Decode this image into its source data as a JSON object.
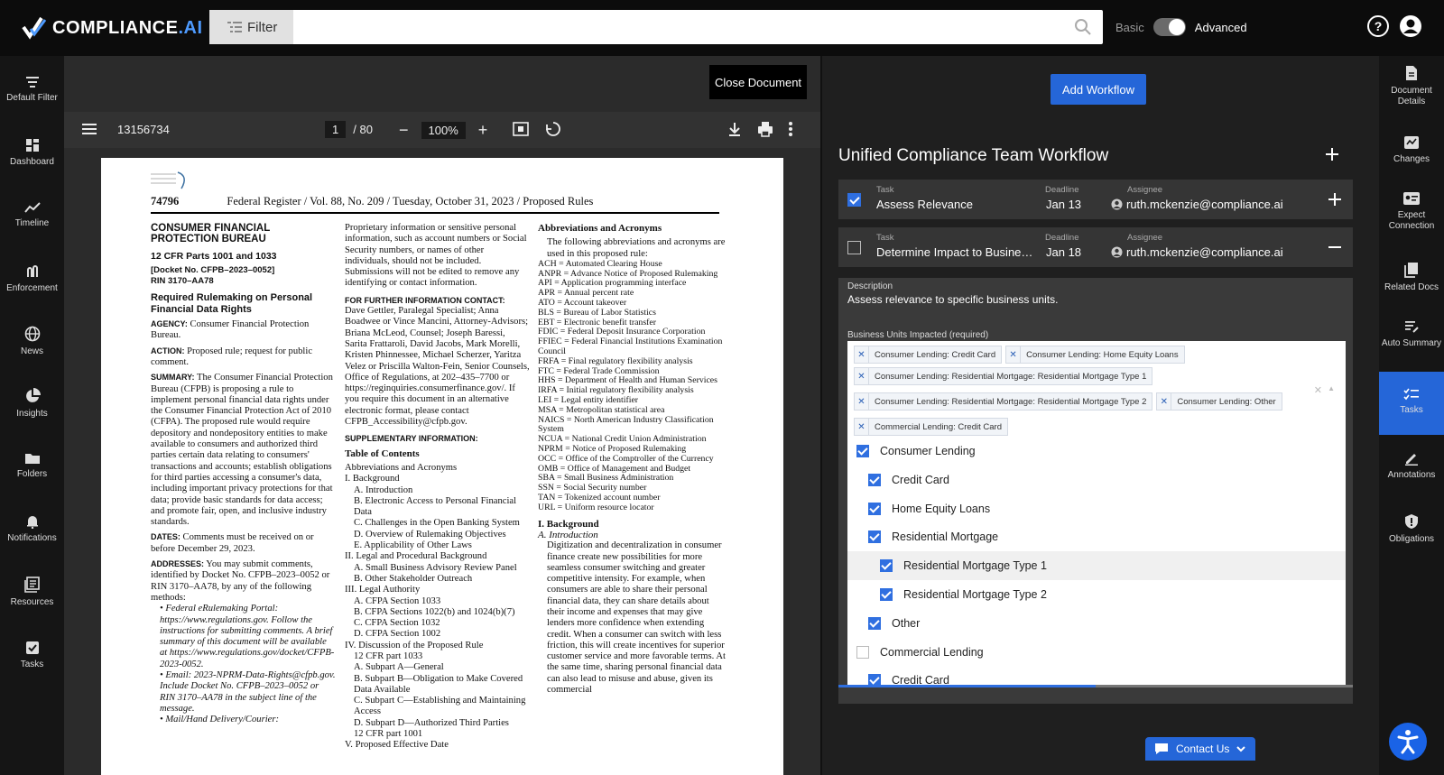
{
  "app": {
    "logo_main": "COMPLIANCE",
    "logo_suffix": ".AI"
  },
  "search": {
    "filter_label": "Filter",
    "placeholder": ""
  },
  "mode_toggle": {
    "left": "Basic",
    "right": "Advanced",
    "selected": "Advanced"
  },
  "left_nav": [
    {
      "label": "Default Filter",
      "icon": "filter-lines-icon"
    },
    {
      "label": "Dashboard",
      "icon": "dashboard-icon"
    },
    {
      "label": "Timeline",
      "icon": "timeline-icon"
    },
    {
      "label": "Enforcement",
      "icon": "enforcement-icon"
    },
    {
      "label": "News",
      "icon": "globe-icon"
    },
    {
      "label": "Insights",
      "icon": "pie-chart-icon"
    },
    {
      "label": "Folders",
      "icon": "folder-icon"
    },
    {
      "label": "Notifications",
      "icon": "bell-icon"
    },
    {
      "label": "Resources",
      "icon": "resources-icon"
    },
    {
      "label": "Tasks",
      "icon": "checkbox-icon"
    }
  ],
  "right_nav": [
    {
      "label": "Document Details",
      "icon": "document-icon"
    },
    {
      "label": "Changes",
      "icon": "changes-icon"
    },
    {
      "label": "Expect Connection",
      "icon": "connection-icon"
    },
    {
      "label": "Related Docs",
      "icon": "related-docs-icon"
    },
    {
      "label": "Auto Summary",
      "icon": "summary-icon"
    },
    {
      "label": "Tasks",
      "icon": "tasks-icon",
      "active": true
    },
    {
      "label": "Annotations",
      "icon": "pen-icon"
    },
    {
      "label": "Obligations",
      "icon": "shield-icon"
    }
  ],
  "document": {
    "close_label": "Close Document",
    "doc_id": "13156734",
    "page_current": "1",
    "page_total": "/ 80",
    "zoom": "100%",
    "header": {
      "page_number": "74796",
      "publication": "Federal Register / Vol. 88, No. 209 / Tuesday, October 31, 2023 / Proposed Rules"
    },
    "col1": {
      "agency": "CONSUMER FINANCIAL PROTECTION BUREAU",
      "cfr": "12 CFR Parts 1001 and 1033",
      "docket": "[Docket No. CFPB–2023–0052]",
      "rin": "RIN 3170–AA78",
      "rule_title": "Required Rulemaking on Personal Financial Data Rights",
      "agency_label": "AGENCY:",
      "agency_text": "Consumer Financial Protection Bureau.",
      "action_label": "ACTION:",
      "action_text": "Proposed rule; request for public comment.",
      "summary_label": "SUMMARY:",
      "summary_text": "The Consumer Financial Protection Bureau (CFPB) is proposing a rule to implement personal financial data rights under the Consumer Financial Protection Act of 2010 (CFPA). The proposed rule would require depository and nondepository entities to make available to consumers and authorized third parties certain data relating to consumers' transactions and accounts; establish obligations for third parties accessing a consumer's data, including important privacy protections for that data; provide basic standards for data access; and promote fair, open, and inclusive industry standards.",
      "dates_label": "DATES:",
      "dates_text": "Comments must be received on or before December 29, 2023.",
      "addresses_label": "ADDRESSES:",
      "addresses_text": "You may submit comments, identified by Docket No. CFPB–2023–0052 or RIN 3170–AA78, by any of the following methods:",
      "bullet1": "• Federal eRulemaking Portal: https://www.regulations.gov. Follow the instructions for submitting comments. A brief summary of this document will be available at https://www.regulations.gov/docket/CFPB-2023-0052.",
      "bullet2": "• Email: 2023-NPRM-Data-Rights@cfpb.gov. Include Docket No. CFPB–2023–0052 or RIN 3170–AA78 in the subject line of the message.",
      "bullet3": "• Mail/Hand Delivery/Courier:"
    },
    "col2": {
      "intro": "Proprietary information or sensitive personal information, such as account numbers or Social Security numbers, or names of other individuals, should not be included. Submissions will not be edited to remove any identifying or contact information.",
      "contact_label": "FOR FURTHER INFORMATION CONTACT:",
      "contact_text": "Dave Gettler, Paralegal Specialist; Anna Boadwee or Vince Mancini, Attorney-Advisors; Briana McLeod, Counsel; Joseph Baressi, Sarita Frattaroli, David Jacobs, Mark Morelli, Kristen Phinnessee, Michael Scherzer, Yaritza Velez or Priscilla Walton-Fein, Senior Counsels, Office of Regulations, at 202–435–7700 or https://reginquiries.consumerfinance.gov/. If you require this document in an alternative electronic format, please contact CFPB_Accessibility@cfpb.gov.",
      "supp_label": "SUPPLEMENTARY INFORMATION:",
      "toc_title": "Table of Contents",
      "toc": [
        {
          "t": "Abbreviations and Acronyms",
          "lvl": 0
        },
        {
          "t": "I. Background",
          "lvl": 0
        },
        {
          "t": "A. Introduction",
          "lvl": 1
        },
        {
          "t": "B. Electronic Access to Personal Financial Data",
          "lvl": 1
        },
        {
          "t": "C. Challenges in the Open Banking System",
          "lvl": 1
        },
        {
          "t": "D. Overview of Rulemaking Objectives",
          "lvl": 1
        },
        {
          "t": "E. Applicability of Other Laws",
          "lvl": 1
        },
        {
          "t": "II. Legal and Procedural Background",
          "lvl": 0
        },
        {
          "t": "A. Small Business Advisory Review Panel",
          "lvl": 1
        },
        {
          "t": "B. Other Stakeholder Outreach",
          "lvl": 1
        },
        {
          "t": "III. Legal Authority",
          "lvl": 0
        },
        {
          "t": "A. CFPA Section 1033",
          "lvl": 1
        },
        {
          "t": "B. CFPA Sections 1022(b) and 1024(b)(7)",
          "lvl": 1
        },
        {
          "t": "C. CFPA Section 1032",
          "lvl": 1
        },
        {
          "t": "D. CFPA Section 1002",
          "lvl": 1
        },
        {
          "t": "IV. Discussion of the Proposed Rule",
          "lvl": 0
        },
        {
          "t": "12 CFR part 1033",
          "lvl": 1
        },
        {
          "t": "A. Subpart A—General",
          "lvl": 1
        },
        {
          "t": "B. Subpart B—Obligation to Make Covered Data Available",
          "lvl": 1
        },
        {
          "t": "C. Subpart C—Establishing and Maintaining Access",
          "lvl": 1
        },
        {
          "t": "D. Subpart D—Authorized Third Parties",
          "lvl": 1
        },
        {
          "t": "12 CFR part 1001",
          "lvl": 1
        },
        {
          "t": "V. Proposed Effective Date",
          "lvl": 0
        }
      ]
    },
    "col3": {
      "abbr_title": "Abbreviations and Acronyms",
      "abbr_intro": "The following abbreviations and acronyms are used in this proposed rule:",
      "abbr": [
        "ACH = Automated Clearing House",
        "ANPR = Advance Notice of Proposed Rulemaking",
        "API = Application programming interface",
        "APR = Annual percent rate",
        "ATO = Account takeover",
        "BLS = Bureau of Labor Statistics",
        "EBT = Electronic benefit transfer",
        "FDIC = Federal Deposit Insurance Corporation",
        "FFIEC = Federal Financial Institutions Examination Council",
        "FRFA = Final regulatory flexibility analysis",
        "FTC = Federal Trade Commission",
        "HHS = Department of Health and Human Services",
        "IRFA = Initial regulatory flexibility analysis",
        "LEI = Legal entity identifier",
        "MSA = Metropolitan statistical area",
        "NAICS = North American Industry Classification System",
        "NCUA = National Credit Union Administration",
        "NPRM = Notice of Proposed Rulemaking",
        "OCC = Office of the Comptroller of the Currency",
        "OMB = Office of Management and Budget",
        "SBA = Small Business Administration",
        "SSN = Social Security number",
        "TAN = Tokenized account number",
        "URL = Uniform resource locator"
      ],
      "section_title": "I. Background",
      "subsection": "A. Introduction",
      "intro_text": "Digitization and decentralization in consumer finance create new possibilities for more seamless consumer switching and greater competitive intensity. For example, when consumers are able to share their personal financial data, they can share details about their income and expenses that may give lenders more confidence when extending credit. When a consumer can switch with less friction, this will create incentives for superior customer service and more favorable terms. At the same time, sharing personal financial data can also lead to misuse and abuse, given its commercial"
    }
  },
  "workflow": {
    "add_label": "Add Workflow",
    "title": "Unified Compliance Team Workflow",
    "task_label": "Task",
    "deadline_label": "Deadline",
    "assignee_label": "Assignee",
    "tasks": [
      {
        "name": "Assess Relevance",
        "deadline": "Jan 13",
        "assignee": "ruth.mckenzie@compliance.ai",
        "checked": true
      },
      {
        "name": "Determine Impact to Busine…",
        "deadline": "Jan 18",
        "assignee": "ruth.mckenzie@compliance.ai",
        "checked": false
      }
    ],
    "description_label": "Description",
    "description": "Assess relevance to specific business units.",
    "bu_label": "Business Units Impacted (required)",
    "chips": [
      "Consumer Lending: Credit Card",
      "Consumer Lending: Home Equity Loans",
      "Consumer Lending: Residential Mortgage: Residential Mortgage Type 1",
      "Consumer Lending: Residential Mortgage: Residential Mortgage Type 2",
      "Consumer Lending: Other",
      "Commercial Lending: Credit Card"
    ],
    "options": [
      {
        "label": "Consumer Lending",
        "level": 0,
        "checked": true
      },
      {
        "label": "Credit Card",
        "level": 1,
        "checked": true
      },
      {
        "label": "Home Equity Loans",
        "level": 1,
        "checked": true
      },
      {
        "label": "Residential Mortgage",
        "level": 1,
        "checked": true
      },
      {
        "label": "Residential Mortgage Type 1",
        "level": 2,
        "checked": true,
        "hover": true
      },
      {
        "label": "Residential Mortgage Type 2",
        "level": 2,
        "checked": true
      },
      {
        "label": "Other",
        "level": 1,
        "checked": true
      },
      {
        "label": "Commercial Lending",
        "level": 0,
        "checked": false
      },
      {
        "label": "Credit Card",
        "level": 1,
        "checked": true
      }
    ],
    "progress": 0.5,
    "contact_label": "Contact Us"
  },
  "colors": {
    "accent": "#2566d8",
    "sidebar": "#151515",
    "topbar": "#0c0c0c"
  }
}
